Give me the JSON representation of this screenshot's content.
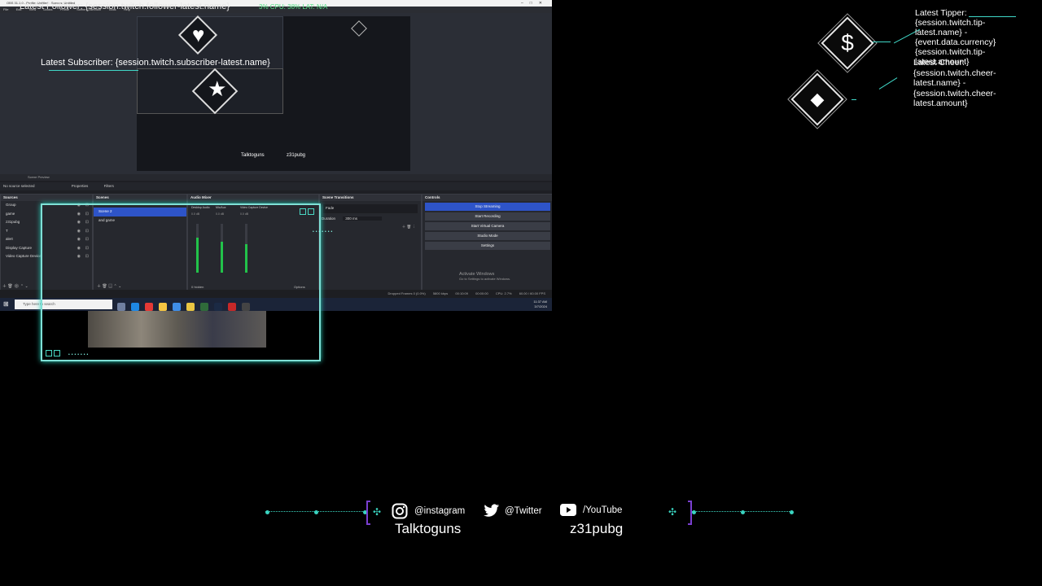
{
  "obs": {
    "window_title": "OBS 31.1.0 - Profile: Untitled - Scenes: Untitled",
    "menu": [
      "File",
      "Edit",
      "View",
      "Docks",
      "Profile",
      "Scene Collection",
      "Tools",
      "Help"
    ],
    "scene_preview_label": "Scene Preview",
    "no_source": "No source selected",
    "properties": "Properties",
    "filters": "Filters",
    "docks": {
      "sources": {
        "title": "Sources",
        "items": [
          "Group",
          "game",
          "z31pubg",
          "T",
          "alert",
          "Display Capture",
          "Video Capture Device"
        ]
      },
      "scenes": {
        "title": "Scenes",
        "items": [
          "Scene 2",
          "and game"
        ],
        "selected": "Scene 2"
      },
      "audio": {
        "title": "Audio Mixer",
        "channels": [
          {
            "name": "Desktop Audio",
            "db": "0.0 dB",
            "level": 0.72
          },
          {
            "name": "Mic/Aux",
            "db": "0.0 dB",
            "level": 0.64
          },
          {
            "name": "Video Capture Device",
            "db": "0.0 dB",
            "level": 0.58
          }
        ],
        "hidden": "0 hidden",
        "options": "Options"
      },
      "transitions": {
        "title": "Scene Transitions",
        "type": "Fade",
        "duration_label": "Duration",
        "duration_value": "300 ms"
      },
      "controls": {
        "title": "Controls",
        "buttons": [
          "Stop Streaming",
          "Start Recording",
          "Start Virtual Camera",
          "Studio Mode",
          "Settings"
        ]
      }
    },
    "activate": {
      "title": "Activate Windows",
      "sub": "Go to Settings to activate Windows."
    },
    "status": {
      "dropped": "Dropped Frames 0 (0.0%)",
      "bitrate": "5800 kbps",
      "stream_time": "00:10:09",
      "rec_time": "00:00:00",
      "cpu": "CPU: 2.7%",
      "fps": "60.00 / 60.00 FPS"
    },
    "taskbar": {
      "search_placeholder": "Type here to search",
      "clock": "11:37 AM",
      "date": "3/7/2024"
    }
  },
  "overlay": {
    "latest_follower": "Latest Follower: {session.twitch.follower-latest.name}",
    "latest_subscriber": "Latest Subscriber: {session.twitch.subscriber-latest.name}",
    "stats_text": "3%    CPU: 38%    LAT: N/A",
    "tipper": "Latest Tipper: {session.twitch.tip-latest.name} - {event.data.currency}{session.twitch.tip-latest.amount}",
    "cheer": "Latest Cheer: {session.twitch.cheer-latest.name} - {session.twitch.cheer-latest.amount}"
  },
  "social": {
    "instagram": "@instagram",
    "twitter": "@Twitter",
    "youtube": "/YouTube",
    "name_left": "Talktoguns",
    "name_right": "z31pubg"
  },
  "colors": {
    "accent": "#3ad4c0",
    "bracket": "#7a3fd0",
    "obs_blue": "#2e54c8"
  }
}
